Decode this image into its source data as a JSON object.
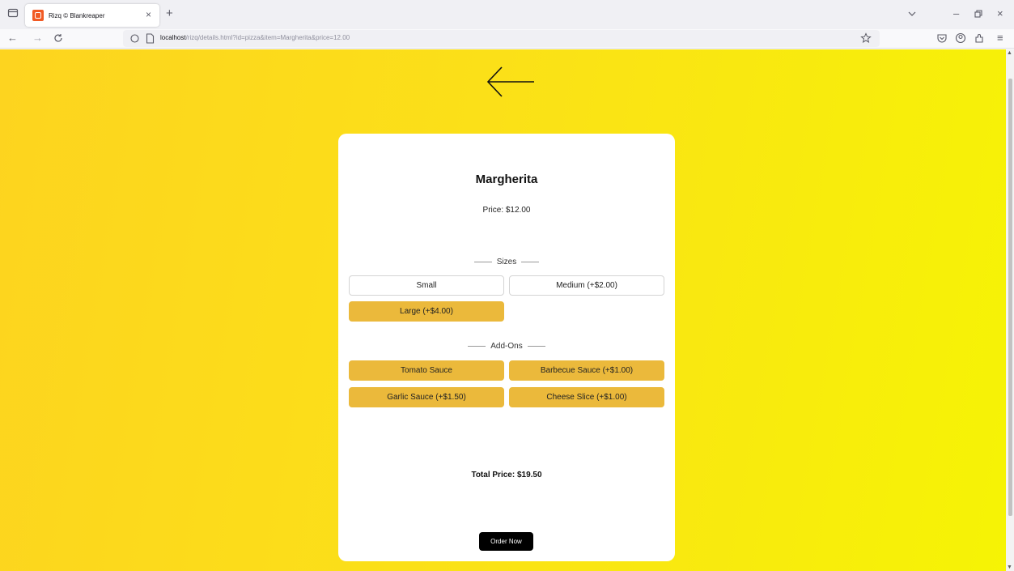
{
  "browser": {
    "tab_title": "Rizq © Blankreaper",
    "tab_close": "×",
    "new_tab": "+",
    "url_host": "localhost",
    "url_rest": "/rizq/details.html?id=pizza&item=Margherita&price=12.00",
    "icons": [
      "tabs-icon",
      "back-icon",
      "forward-icon",
      "reload-icon",
      "shield-icon",
      "page-icon",
      "bookmark-star-icon",
      "pocket-icon",
      "account-icon",
      "extensions-icon",
      "menu-icon",
      "minimize-icon",
      "maximize-icon",
      "close-icon"
    ]
  },
  "nav": {
    "back": "←",
    "forward": "→",
    "reload": "C"
  },
  "window": {
    "minimize": "–",
    "close": "×",
    "menu": "≡"
  },
  "page": {
    "item_name": "Margherita",
    "price_text": "Price: $12.00",
    "sizes_heading": "Sizes",
    "addons_heading": "Add-Ons",
    "sizes": [
      {
        "label": "Small",
        "selected": false
      },
      {
        "label": "Medium (+$2.00)",
        "selected": false
      },
      {
        "label": "Large (+$4.00)",
        "selected": true
      }
    ],
    "addons": [
      {
        "label": "Tomato Sauce",
        "selected": true
      },
      {
        "label": "Barbecue Sauce (+$1.00)",
        "selected": true
      },
      {
        "label": "Garlic Sauce (+$1.50)",
        "selected": true
      },
      {
        "label": "Cheese Slice (+$1.00)",
        "selected": true
      }
    ],
    "total_text": "Total Price: $19.50",
    "order_button": "Order Now"
  },
  "colors": {
    "selected_option": "#ebb93b",
    "background_start": "#fdd41f",
    "background_end": "#f6f404"
  }
}
